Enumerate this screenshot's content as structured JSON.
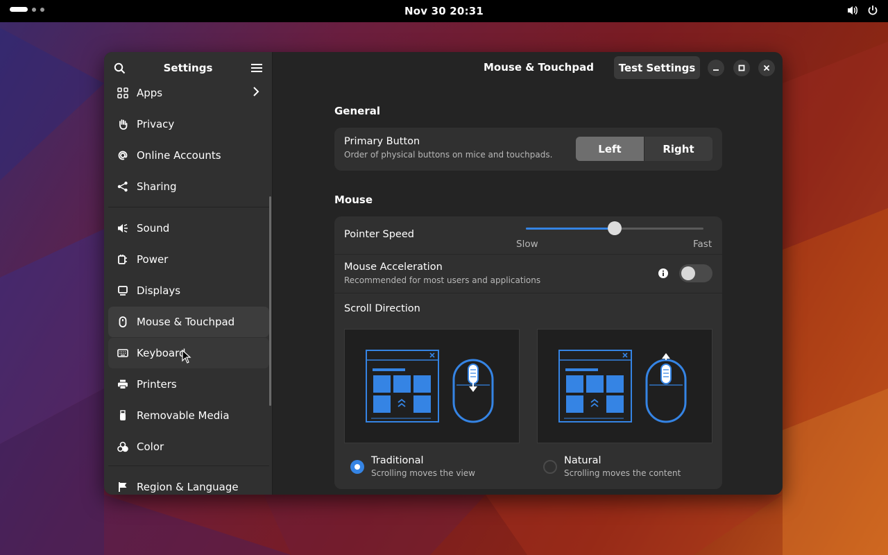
{
  "topbar": {
    "clock": "Nov 30  20:31",
    "icons": [
      "volume-icon",
      "power-icon"
    ]
  },
  "window": {
    "sidebar_title": "Settings",
    "title": "Mouse & Touchpad",
    "test_button": "Test Settings"
  },
  "sidebar": {
    "items": [
      {
        "label": "Apps",
        "icon": "apps-grid-icon"
      },
      {
        "label": "Privacy",
        "icon": "hand-icon"
      },
      {
        "label": "Online Accounts",
        "icon": "at-sign-icon"
      },
      {
        "label": "Sharing",
        "icon": "share-icon"
      },
      {
        "label": "Sound",
        "icon": "speaker-icon"
      },
      {
        "label": "Power",
        "icon": "power-plug-icon"
      },
      {
        "label": "Displays",
        "icon": "monitor-icon"
      },
      {
        "label": "Mouse & Touchpad",
        "icon": "mouse-icon"
      },
      {
        "label": "Keyboard",
        "icon": "keyboard-icon"
      },
      {
        "label": "Printers",
        "icon": "printer-icon"
      },
      {
        "label": "Removable Media",
        "icon": "usb-icon"
      },
      {
        "label": "Color",
        "icon": "color-icon"
      },
      {
        "label": "Region & Language",
        "icon": "flag-icon"
      }
    ],
    "selected": "Mouse & Touchpad"
  },
  "general": {
    "heading": "General",
    "primary_button": {
      "title": "Primary Button",
      "subtitle": "Order of physical buttons on mice and touchpads.",
      "options": [
        "Left",
        "Right"
      ],
      "selected": "Left"
    }
  },
  "mouse": {
    "heading": "Mouse",
    "pointer_speed": {
      "title": "Pointer Speed",
      "min_label": "Slow",
      "max_label": "Fast",
      "value": 0.5
    },
    "acceleration": {
      "title": "Mouse Acceleration",
      "subtitle": "Recommended for most users and applications",
      "enabled": false
    },
    "scroll_direction": {
      "title": "Scroll Direction",
      "options": [
        {
          "title": "Traditional",
          "subtitle": "Scrolling moves the view",
          "selected": true
        },
        {
          "title": "Natural",
          "subtitle": "Scrolling moves the content",
          "selected": false
        }
      ]
    }
  },
  "colors": {
    "accent": "#3584e4",
    "window_bg": "#242424",
    "sidebar_bg": "#303030"
  }
}
